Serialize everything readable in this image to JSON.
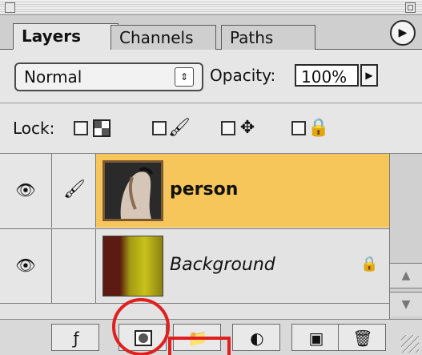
{
  "tabs": [
    "Layers",
    "Channels",
    "Paths"
  ],
  "blend": {
    "mode": "Normal",
    "select_arrows_icon": "updown-arrows-icon",
    "opacity_label": "Opacity:",
    "opacity_value": "100%",
    "opacity_arrow_icon": "triangle-right-icon"
  },
  "lock": {
    "label": "Lock:",
    "options": [
      {
        "icon": "transparency-checker-icon"
      },
      {
        "icon": "brush-icon"
      },
      {
        "icon": "move-cross-icon"
      },
      {
        "icon": "padlock-icon"
      }
    ]
  },
  "layers": [
    {
      "name": "person",
      "selected": true,
      "visible": true,
      "linked_icon": "brush-icon"
    },
    {
      "name": "Background",
      "selected": false,
      "visible": true,
      "locked": true
    }
  ],
  "toolbar": {
    "buttons": [
      {
        "icon": "layer-style-icon"
      },
      {
        "icon": "add-layer-mask-icon"
      },
      {
        "icon": "new-layer-set-folder-icon"
      },
      {
        "icon": "adjustment-layer-icon"
      },
      {
        "icon": "new-layer-icon"
      },
      {
        "icon": "trash-icon"
      }
    ]
  },
  "annotation_color": "#e01f1f",
  "selected_row_color": "#f7c65a"
}
